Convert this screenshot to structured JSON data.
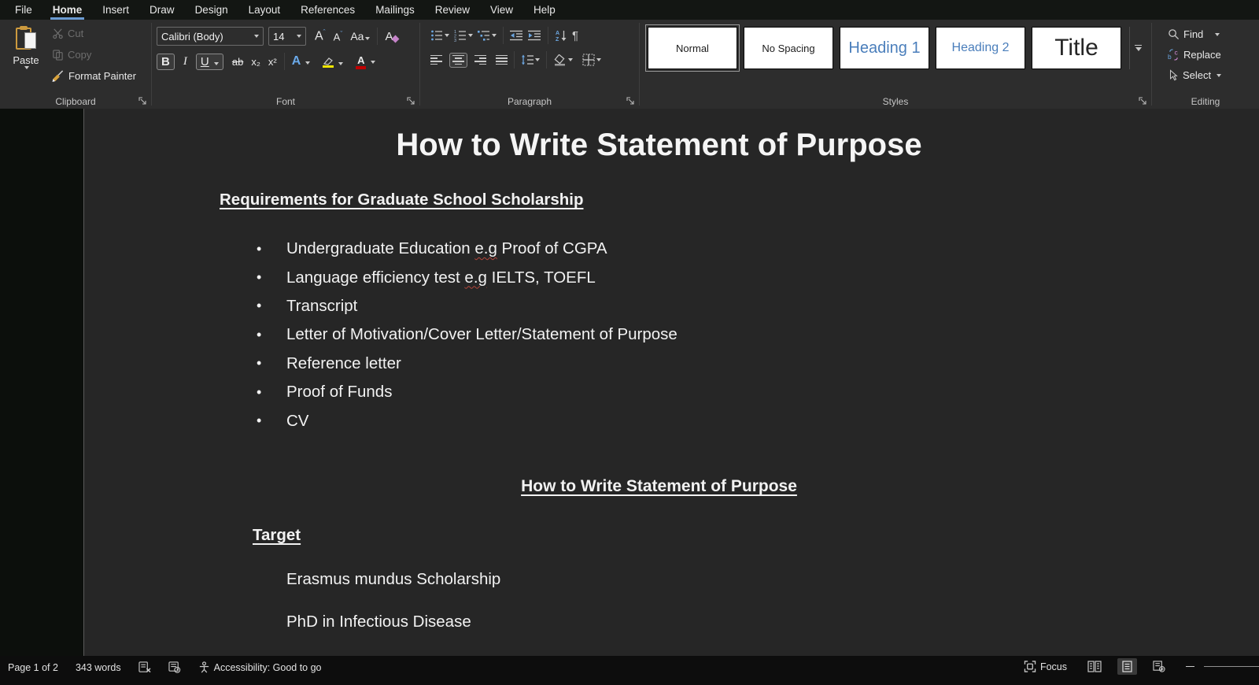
{
  "menu_bar": {
    "tabs": [
      {
        "label": "File"
      },
      {
        "label": "Home",
        "active": true
      },
      {
        "label": "Insert"
      },
      {
        "label": "Draw"
      },
      {
        "label": "Design"
      },
      {
        "label": "Layout"
      },
      {
        "label": "References"
      },
      {
        "label": "Mailings"
      },
      {
        "label": "Review"
      },
      {
        "label": "View"
      },
      {
        "label": "Help"
      }
    ]
  },
  "ribbon": {
    "clipboard": {
      "group_label": "Clipboard",
      "paste_label": "Paste",
      "cut_label": "Cut",
      "copy_label": "Copy",
      "format_painter_label": "Format Painter"
    },
    "font": {
      "group_label": "Font",
      "font_name": "Calibri (Body)",
      "font_size": "14",
      "grow_font": "A",
      "shrink_font": "A",
      "change_case": "Aa",
      "clear_format": "A",
      "bold": "B",
      "italic": "I",
      "underline": "U",
      "strikethrough": "ab",
      "subscript": "x₂",
      "superscript": "x²",
      "text_effects": "A",
      "font_color": "A"
    },
    "paragraph": {
      "group_label": "Paragraph"
    },
    "styles": {
      "group_label": "Styles",
      "items": [
        {
          "label": "Normal",
          "selected": true
        },
        {
          "label": "No Spacing"
        },
        {
          "label": "Heading 1"
        },
        {
          "label": "Heading 2"
        },
        {
          "label": "Title"
        }
      ]
    },
    "editing": {
      "group_label": "Editing",
      "find_label": "Find",
      "replace_label": "Replace",
      "select_label": "Select"
    }
  },
  "document": {
    "title": "How to Write Statement of Purpose",
    "section1_heading": "Requirements for Graduate School Scholarship",
    "bullets": [
      [
        {
          "t": "Undergraduate Education "
        },
        {
          "t": "e.g",
          "err": true
        },
        {
          "t": " Proof of CGPA"
        }
      ],
      [
        {
          "t": "Language efficiency test "
        },
        {
          "t": "e.g",
          "err": true
        },
        {
          "t": " IELTS, TOEFL"
        }
      ],
      [
        {
          "t": "Transcript"
        }
      ],
      [
        {
          "t": "Letter of Motivation/Cover Letter/Statement of Purpose"
        }
      ],
      [
        {
          "t": "Reference letter"
        }
      ],
      [
        {
          "t": "Proof of Funds"
        }
      ],
      [
        {
          "t": "CV"
        }
      ]
    ],
    "section2_heading": "How to Write Statement of Purpose",
    "target_heading": "Target",
    "target_items": [
      "Erasmus mundus Scholarship",
      "PhD in Infectious Disease"
    ]
  },
  "status_bar": {
    "page_info": "Page 1 of 2",
    "word_count": "343 words",
    "accessibility": "Accessibility: Good to go",
    "focus_label": "Focus"
  },
  "icons": {
    "pilcrow": "¶",
    "bullet": "•"
  },
  "colors": {
    "accent_blue": "#6b9bd2",
    "heading_blue": "#4a7ebb",
    "highlight_yellow": "#f3e600",
    "font_color_red": "#c00000",
    "clipboard_orange": "#cd9a3e",
    "squiggle_red": "#b4453a"
  }
}
